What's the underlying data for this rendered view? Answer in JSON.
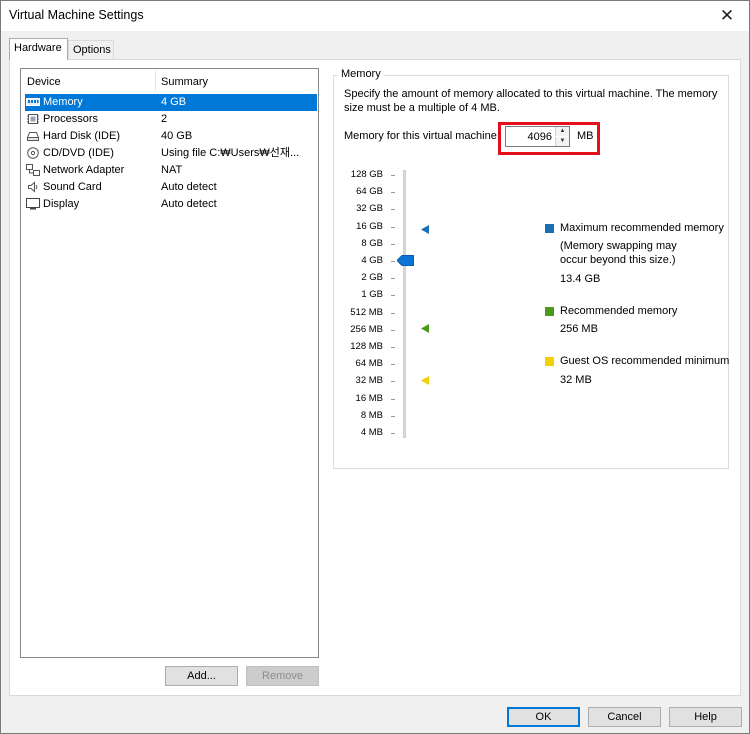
{
  "window": {
    "title": "Virtual Machine Settings"
  },
  "tabs": {
    "hardware": "Hardware",
    "options": "Options"
  },
  "devices": {
    "col_device": "Device",
    "col_summary": "Summary",
    "rows": [
      {
        "name": "Memory",
        "summary": "4 GB",
        "icon": "memory-icon",
        "selected": true
      },
      {
        "name": "Processors",
        "summary": "2",
        "icon": "processor-icon"
      },
      {
        "name": "Hard Disk (IDE)",
        "summary": "40 GB",
        "icon": "hard-disk-icon"
      },
      {
        "name": "CD/DVD (IDE)",
        "summary": "Using file C:₩Users₩선재...",
        "icon": "cd-dvd-icon"
      },
      {
        "name": "Network Adapter",
        "summary": "NAT",
        "icon": "network-adapter-icon"
      },
      {
        "name": "Sound Card",
        "summary": "Auto detect",
        "icon": "sound-card-icon"
      },
      {
        "name": "Display",
        "summary": "Auto detect",
        "icon": "display-icon"
      }
    ],
    "add_label": "Add...",
    "remove_label": "Remove"
  },
  "memory": {
    "group_title": "Memory",
    "description": "Specify the amount of memory allocated to this virtual machine. The memory size must be a multiple of 4 MB.",
    "field_label": "Memory for this virtual machine:",
    "value": "4096",
    "unit": "MB",
    "scale_labels": [
      "128 GB",
      "64 GB",
      "32 GB",
      "16 GB",
      "8 GB",
      "4 GB",
      "2 GB",
      "1 GB",
      "512 MB",
      "256 MB",
      "128 MB",
      "64 MB",
      "32 MB",
      "16 MB",
      "8 MB",
      "4 MB"
    ],
    "legend": {
      "max_title": "Maximum recommended memory",
      "max_note": "(Memory swapping may occur beyond this size.)",
      "max_value": "13.4 GB",
      "rec_title": "Recommended memory",
      "rec_value": "256 MB",
      "min_title": "Guest OS recommended minimum",
      "min_value": "32 MB"
    },
    "colors": {
      "max": "#1a6fb5",
      "recommended": "#4a9a1e",
      "minimum": "#f2d100",
      "highlight": "#e3101b"
    }
  },
  "footer": {
    "ok": "OK",
    "cancel": "Cancel",
    "help": "Help"
  }
}
